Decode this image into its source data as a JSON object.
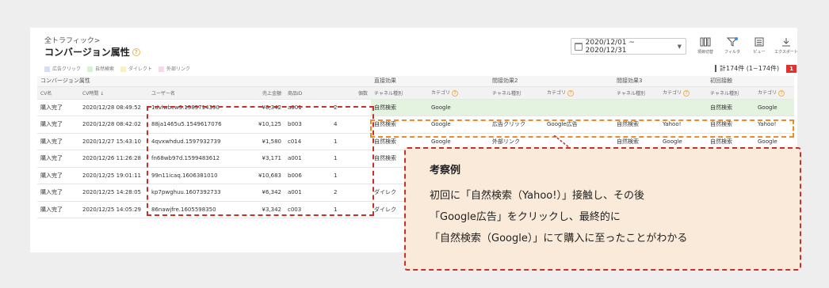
{
  "breadcrumb": "全トラフィック>",
  "page_title": "コンバージョン属性",
  "date_range": "2020/12/01 ~ 2020/12/31",
  "toolbar": [
    {
      "label": "項目切替",
      "icon": "columns-icon"
    },
    {
      "label": "フィルタ",
      "icon": "filter-icon"
    },
    {
      "label": "ビュー",
      "icon": "view-icon"
    },
    {
      "label": "エクスポート",
      "icon": "export-icon"
    }
  ],
  "legend": [
    {
      "label": "広告クリック",
      "color": "#d8dcf5"
    },
    {
      "label": "自然検索",
      "color": "#d9f0d2"
    },
    {
      "label": "ダイレクト",
      "color": "#f7f1c8"
    },
    {
      "label": "外部リンク",
      "color": "#f5dbe8"
    }
  ],
  "count_text": "計174件 (1~174件)",
  "count_badge": "1",
  "table": {
    "groups": [
      {
        "label": "コンバージョン属性"
      },
      {
        "label": "直接効果"
      },
      {
        "label": "間接効果2"
      },
      {
        "label": "間接効果3"
      },
      {
        "label": "初回接触"
      }
    ],
    "columns": [
      "CV名",
      "CV時間 ↓",
      "ユーザー名",
      "売上金額",
      "商品ID",
      "個数",
      "チャネル種別",
      "カテゴリ",
      "チャネル種別",
      "カテゴリ",
      "チャネル種別",
      "カテゴリ",
      "チャネル種別",
      "カテゴリ"
    ],
    "rows": [
      [
        "購入完了",
        "2020/12/28 08:49:52",
        "1dvlwbcw5.1585714390",
        "¥6,342",
        "a001",
        "2",
        "自然検索",
        "Google",
        "",
        "",
        "",
        "",
        "自然検索",
        "Google"
      ],
      [
        "購入完了",
        "2020/12/28 08:42:02",
        "88ja1465u5.1549617076",
        "¥10,125",
        "b003",
        "4",
        "自然検索",
        "Google",
        "広告クリック",
        "Google広告",
        "自然検索",
        "Yahoo!",
        "自然検索",
        "Yahoo!"
      ],
      [
        "購入完了",
        "2020/12/27 15:43:10",
        "4qvxwhdud.1597932739",
        "¥1,580",
        "c014",
        "1",
        "自然検索",
        "Google",
        "外部リンク",
        "",
        "自然検索",
        "Google",
        "自然検索",
        "Google"
      ],
      [
        "購入完了",
        "2020/12/26 11:26:28",
        "fn68wb97d.1599483612",
        "¥3,171",
        "a001",
        "1",
        "自然検索",
        "",
        "",
        "",
        "",
        "",
        "",
        ""
      ],
      [
        "購入完了",
        "2020/12/25 19:01:11",
        "99n11icaq.1606381010",
        "¥10,683",
        "b006",
        "1",
        "",
        "",
        "",
        "",
        "",
        "",
        "",
        ""
      ],
      [
        "購入完了",
        "2020/12/25 14:28:05",
        "kp7pwghuu.1607392733",
        "¥6,342",
        "a001",
        "2",
        "ダイレク",
        "",
        "",
        "",
        "",
        "",
        "",
        ""
      ],
      [
        "購入完了",
        "2020/12/25 14:05:29",
        "86nawjfre.1605598350",
        "¥3,342",
        "c003",
        "1",
        "ダイレク",
        "",
        "",
        "",
        "",
        "",
        "",
        ""
      ]
    ]
  },
  "callout": {
    "title": "考察例",
    "lines": [
      "初回に「自然検索（Yahoo!）」接触し、その後",
      "「Google広告」をクリックし、最終的に",
      "「自然検索（Google）」にて購入に至ったことがわかる"
    ]
  },
  "colors": {
    "red_frame": "#c9302c",
    "orange_frame": "#f08a24",
    "callout_bg": "#f9ead9",
    "badge": "#e03030",
    "help_icon": "#f0b35a"
  }
}
